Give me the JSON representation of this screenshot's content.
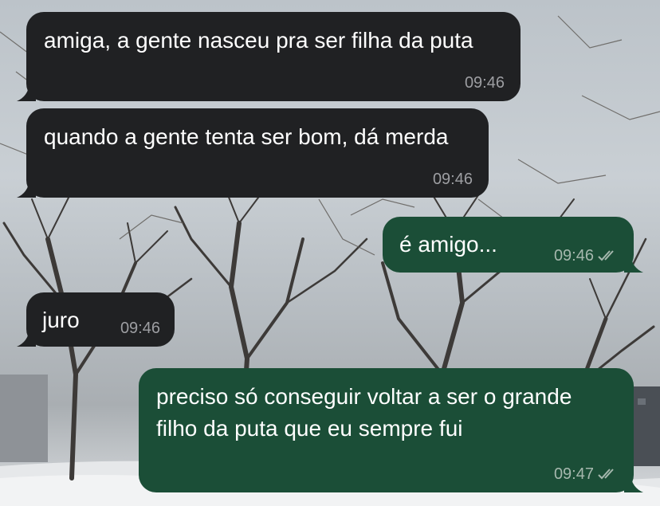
{
  "chat": {
    "messages": [
      {
        "direction": "incoming",
        "text": "amiga, a gente nasceu pra ser filha da puta",
        "time": "09:46"
      },
      {
        "direction": "incoming",
        "text": "quando a gente tenta ser bom, dá merda",
        "time": "09:46"
      },
      {
        "direction": "outgoing",
        "text": "é amigo...",
        "time": "09:46",
        "status_icon": "double-check-icon"
      },
      {
        "direction": "incoming",
        "text": "juro",
        "time": "09:46"
      },
      {
        "direction": "outgoing",
        "text": "preciso só conseguir voltar a ser o grande filho da puta que eu sempre fui",
        "time": "09:47",
        "status_icon": "double-check-icon"
      }
    ]
  },
  "colors": {
    "incoming_bubble": "#202123",
    "outgoing_bubble": "#1b4e37",
    "text": "#ffffff",
    "timestamp": "#9d9ea2"
  },
  "wallpaper": "snowy-park-bare-trees"
}
